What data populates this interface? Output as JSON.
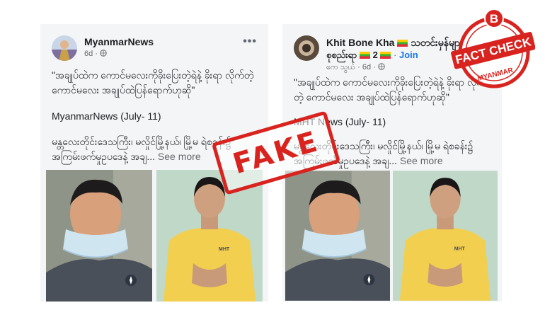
{
  "left_post": {
    "page_name": "MyanmarNews",
    "time": "6d",
    "menu": "•••",
    "quote": "\"အချုပ်ထဲက ကောင်မလေးကိုခိုးပြေးတဲ့ရဲနဲ့ ခိုးရာ လိုက်တဲ့ ကောင်မလေး အချုပ်ထဲပြန်ရောက်ဟုဆို\"",
    "source": "MyanmarNews  (July- 11)",
    "excerpt": "မန္တလေးတိုင်းဒေသကြီး၊ မလှိုင်မြို့နယ်၊ မြို့မ ရဲစခန်း၌ အကြမ်းဖက်မှုဥပဒေနဲ့ အချ...",
    "see_more": "See more"
  },
  "right_post": {
    "page_name": "Khit Bone Kha",
    "group_name": "သတင်းမှန်များ",
    "group_line2": "စုစည်းရာ",
    "group_count": "2",
    "join_label": "Join",
    "author": "ကေ သွယ်",
    "time": "6d",
    "quote": "\"အချုပ်ထဲက ကောင်မလေးကိုခိုးပြေးတဲ့ရဲနဲ့ ခိုးရာ လိုက်တဲ့ ကောင်မလေး အချုပ်ထဲပြန်ရောက်ဟုဆို\"",
    "source": "MHT News (July- 11)",
    "excerpt": "မန္တလေးတိုင်းဒေသကြီး၊ မလှိုင်မြို့နယ်၊ မြို့မ ရဲစခန်း၌ အကြမ်းဖက်မှုဥပဒေနဲ့ အချ...",
    "see_more": "See more"
  },
  "stamp": {
    "label": "FAKE"
  },
  "badge": {
    "letter": "B",
    "title": "FACT CHECK",
    "region": "MYANMAR"
  },
  "photo_shirt_text": "MHT",
  "colors": {
    "stamp": "#d8231f",
    "badge": "#d8231f",
    "join": "#1877f2",
    "card": "#f4f5f7"
  }
}
